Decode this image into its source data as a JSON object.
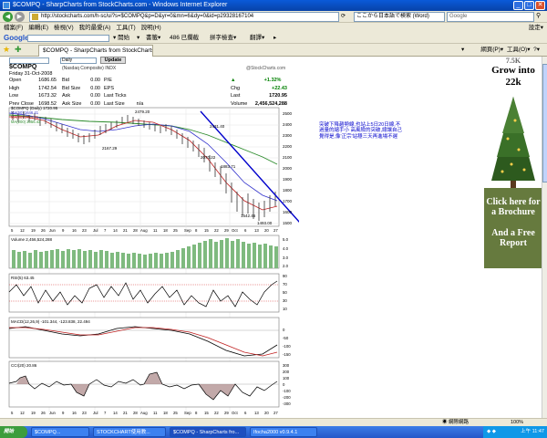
{
  "window": {
    "title": "$COMPQ - SharpCharts from StockCharts.com - Windows Internet Explorer",
    "url": "http://stockcharts.com/h-sc/ui?s=$COMPQ&p=D&yr=0&mn=6&dy=0&id=p29328167104",
    "ie_search": "ここから日本語で検索 (Word)",
    "google_search": "Google"
  },
  "menu": {
    "items": [
      "檔案(F)",
      "編輯(E)",
      "檢視(V)",
      "我的最愛(A)",
      "工具(T)",
      "說明(H)"
    ],
    "right": "設定▾"
  },
  "google_toolbar": {
    "logo": "Google",
    "items": [
      "▾ 開始",
      "▾",
      "書籤▾",
      "486 已攔截",
      "拼字檢查▾",
      "翻譯▾",
      "▸"
    ]
  },
  "favbar": {
    "tab": "$COMPQ - SharpCharts from StockCharts.com",
    "tools": [
      "▾",
      "網頁(P)▾",
      "工具(O)▾",
      "?▾"
    ]
  },
  "chart": {
    "controls": {
      "symbol": "",
      "period": "Daily",
      "update": "Update"
    },
    "title": "$COMPQ",
    "name": "(Nasdaq Composite)",
    "exchange": "INDX",
    "logo": "@StockCharts.com",
    "date": "Friday  31-Oct-2008",
    "quote": [
      {
        "l": "Open",
        "v": "1686.65",
        "l2": "Bid",
        "v2": "0.00",
        "l3": "P/E",
        "v3": ""
      },
      {
        "l": "High",
        "v": "1742.54",
        "l2": "Bid Size",
        "v2": "0.00",
        "l3": "EPS",
        "v3": ""
      },
      {
        "l": "Low",
        "v": "1673.32",
        "l2": "Ask",
        "v2": "0.00",
        "l3": "Last Ticks",
        "v3": ""
      },
      {
        "l": "Prev Close",
        "v": "1698.52",
        "l2": "Ask Size",
        "v2": "0.00",
        "l3": "Last Size",
        "v3": "n/a"
      }
    ],
    "change": {
      "pct": "+1.32%",
      "chg_label": "Chg",
      "chg": "+22.43",
      "last_label": "Last",
      "last": "1720.95",
      "vol_label": "Volume",
      "vol": "2,456,524,288"
    },
    "legend": {
      "main": "$COMPQ (Daily) 1720.95",
      "ma1": "MA(50) 1646.41",
      "ma2": "MA(20) 1714.91",
      "ma3": "MA(200) 2056.43"
    },
    "annotations": {
      "high": "2479.20",
      "a1": "2167.29",
      "a2": "2431.40",
      "a3": "2070.22",
      "a4": "1883.71",
      "a5": "1542.46",
      "a6": "1493.00"
    },
    "xlabels_main": [
      "5",
      "12",
      "19",
      "26",
      "Jun",
      "9",
      "16",
      "23",
      "Jul",
      "7",
      "14",
      "21",
      "28",
      "Aug",
      "11",
      "18",
      "25",
      "Sep",
      "8",
      "15",
      "22",
      "29",
      "Oct",
      "6",
      "13",
      "20",
      "27"
    ],
    "y_main": [
      "2500",
      "2400",
      "2300",
      "2200",
      "2100",
      "2000",
      "1900",
      "1800",
      "1700",
      "1600",
      "1500"
    ],
    "volume_label": "Volume 2,456,524,288",
    "y_vol": [
      "5.0",
      "4.0",
      "3.0",
      "2.0"
    ],
    "rsi_label": "RSI(5) 63.45",
    "y_rsi": [
      "90",
      "70",
      "50",
      "30",
      "10"
    ],
    "macd_label": "MACD(12,26,9) -101.344, -123.838, 22.494",
    "y_macd": [
      "0",
      "-50",
      "-100",
      "-150"
    ],
    "cci_label": "CCI(20) 20.86",
    "y_cci": [
      "300",
      "200",
      "100",
      "0",
      "-100",
      "-200",
      "-300"
    ],
    "xlabels_bottom": [
      "5",
      "12",
      "19",
      "26",
      "Jun",
      "9",
      "16",
      "23",
      "Jul",
      "7",
      "14",
      "21",
      "28",
      "Aug",
      "11",
      "18",
      "25",
      "Sep",
      "8",
      "15",
      "22",
      "29",
      "Oct",
      "6",
      "13",
      "20",
      "27"
    ]
  },
  "note": {
    "text": "突破下降趨勢線,也站上5日20日線,不過量的縮手小 高風險的突破,總讓自己覺得是,像'正宗'站穩三天再進場不遲"
  },
  "ad": {
    "top_number": "7.5K",
    "grow": "Grow into",
    "target": "22k",
    "click": "Click here for a Brochure",
    "free": "And a Free Report"
  },
  "status": {
    "left": "",
    "zone": "網際網路",
    "zoom": "100%"
  },
  "taskbar": {
    "start": "開始",
    "tasks": [
      "$COMPQ...",
      "STOCKCHART使用教...",
      "$COMPQ - SharpCharts fro...",
      "Ifocha2000 v0.9.4.1"
    ],
    "clock": "上午 11:47"
  }
}
